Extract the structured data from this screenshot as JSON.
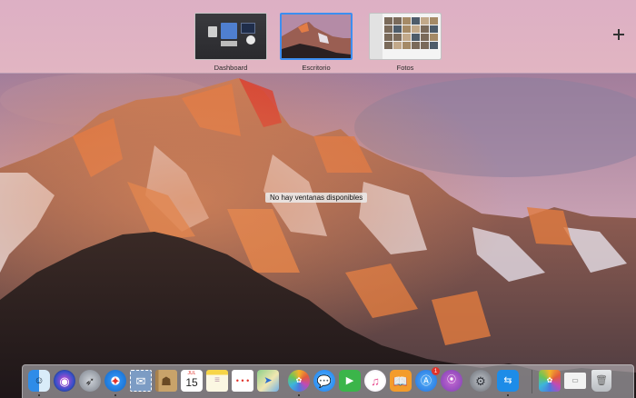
{
  "spaces": [
    {
      "label": "Dashboard",
      "selected": false
    },
    {
      "label": "Escritorio",
      "selected": true
    },
    {
      "label": "Fotos",
      "selected": false
    }
  ],
  "add_space_icon": "plus-icon",
  "desktop": {
    "tooltip": "No hay ventanas disponibles"
  },
  "dock": {
    "apps": [
      {
        "name": "finder",
        "icon": "finder-icon",
        "running": true
      },
      {
        "name": "siri",
        "icon": "siri-icon",
        "running": false
      },
      {
        "name": "launchpad",
        "icon": "launchpad-icon",
        "running": false
      },
      {
        "name": "safari",
        "icon": "safari-icon",
        "running": true
      },
      {
        "name": "mail",
        "icon": "mail-stamp-icon",
        "running": false
      },
      {
        "name": "contacts",
        "icon": "contacts-icon",
        "running": false
      },
      {
        "name": "calendar",
        "icon": "calendar-icon",
        "date": "15",
        "month": "JUL",
        "running": false
      },
      {
        "name": "notes",
        "icon": "notes-icon",
        "running": false
      },
      {
        "name": "reminders",
        "icon": "reminders-icon",
        "running": false
      },
      {
        "name": "maps",
        "icon": "maps-icon",
        "running": false
      },
      {
        "name": "photos",
        "icon": "photos-icon",
        "running": true
      },
      {
        "name": "messages",
        "icon": "messages-icon",
        "running": false
      },
      {
        "name": "facetime",
        "icon": "facetime-icon",
        "running": false
      },
      {
        "name": "itunes",
        "icon": "itunes-icon",
        "running": false
      },
      {
        "name": "ibooks",
        "icon": "ibooks-icon",
        "running": false
      },
      {
        "name": "app-store",
        "icon": "app-store-icon",
        "badge": "1",
        "running": false
      },
      {
        "name": "app-extra",
        "icon": "purple-app-icon",
        "running": false
      },
      {
        "name": "system-preferences",
        "icon": "gear-icon",
        "running": false
      },
      {
        "name": "teamviewer",
        "icon": "teamviewer-icon",
        "running": true
      },
      {
        "name": "photos-folder",
        "icon": "photos-folder-icon",
        "running": false
      },
      {
        "name": "document",
        "icon": "document-icon",
        "running": false
      },
      {
        "name": "trash",
        "icon": "trash-icon",
        "running": false
      }
    ]
  },
  "colors": {
    "selection": "#3d8ef0",
    "spaces_bar": "#e2b4c4"
  }
}
